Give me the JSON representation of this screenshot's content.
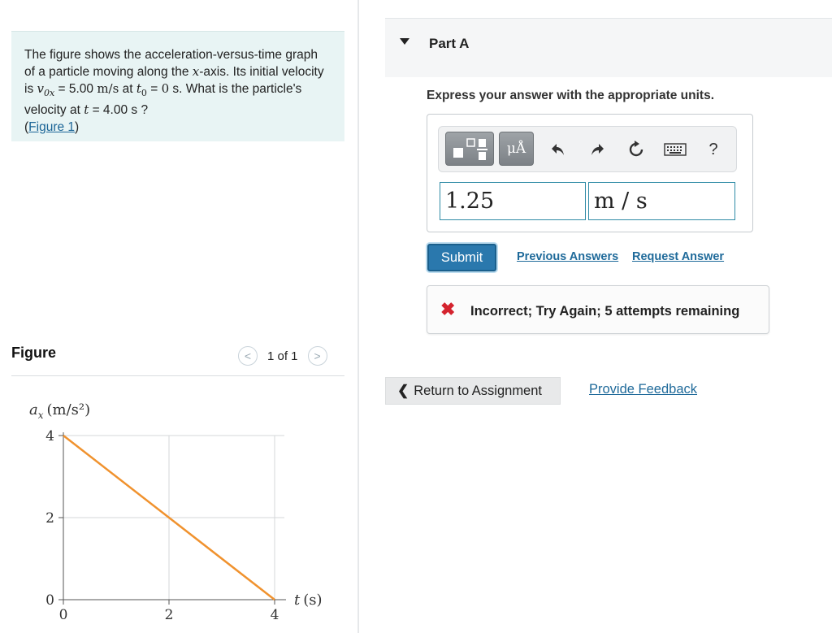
{
  "problem": {
    "text_1": "The figure shows the acceleration-versus-time graph of a particle moving along the ",
    "x_axis_var": "x",
    "text_2": "-axis. Its initial velocity is ",
    "v0x_symbol": "v",
    "v0x_sub": "0x",
    "text_3": " = 5.00 ",
    "v0x_unit": "m/s",
    "text_4": " at ",
    "t0_symbol": "t",
    "t0_sub": "0",
    "text_5": " = ",
    "t0_value": "0",
    "text_6": " s. What is the particle's velocity at ",
    "t_symbol": "t",
    "text_7": " = 4.00 s ?",
    "figure_link_open": "(",
    "figure_link": "Figure 1",
    "figure_link_close": ")"
  },
  "figure": {
    "title": "Figure",
    "pager": "1 of 1",
    "prev_icon": "chevron-left-icon",
    "next_icon": "chevron-right-icon"
  },
  "chart_data": {
    "type": "line",
    "ylabel": "a_x (m/s²)",
    "ylabel_var": "a",
    "ylabel_sub": "x",
    "ylabel_unit": "(m/s²)",
    "xlabel": "t (s)",
    "xlabel_var": "t",
    "xlabel_unit": "(s)",
    "x_ticks": [
      0,
      2,
      4
    ],
    "y_ticks": [
      0,
      2,
      4
    ],
    "xlim": [
      0,
      4
    ],
    "ylim": [
      0,
      4
    ],
    "grid": true,
    "series": [
      {
        "x": [
          0,
          4
        ],
        "y": [
          4,
          0
        ],
        "color": "#f0922e"
      }
    ]
  },
  "part": {
    "title": "Part A",
    "instruction": "Express your answer with the appropriate units.",
    "toolbar": {
      "template_icon": "fraction-template-icon",
      "units_label": "μÅ",
      "undo_icon": "undo-icon",
      "redo_icon": "redo-icon",
      "reset_icon": "reset-icon",
      "keyboard_icon": "keyboard-icon",
      "help_label": "?"
    },
    "value": "1.25",
    "units": "m / s",
    "submit": "Submit",
    "previous_answers": "Previous Answers",
    "request_answer": "Request Answer",
    "feedback_icon": "x-icon",
    "feedback_x": "✖",
    "feedback": "Incorrect; Try Again; 5 attempts remaining"
  },
  "footer": {
    "return_chevron": "❮",
    "return_label": "Return to Assignment",
    "provide_feedback": "Provide Feedback"
  },
  "colors": {
    "problem_bg": "#e8f4f4",
    "line": "#f0922e",
    "submit": "#2a78ad",
    "link": "#1f6a9a",
    "error": "#d4232e"
  }
}
